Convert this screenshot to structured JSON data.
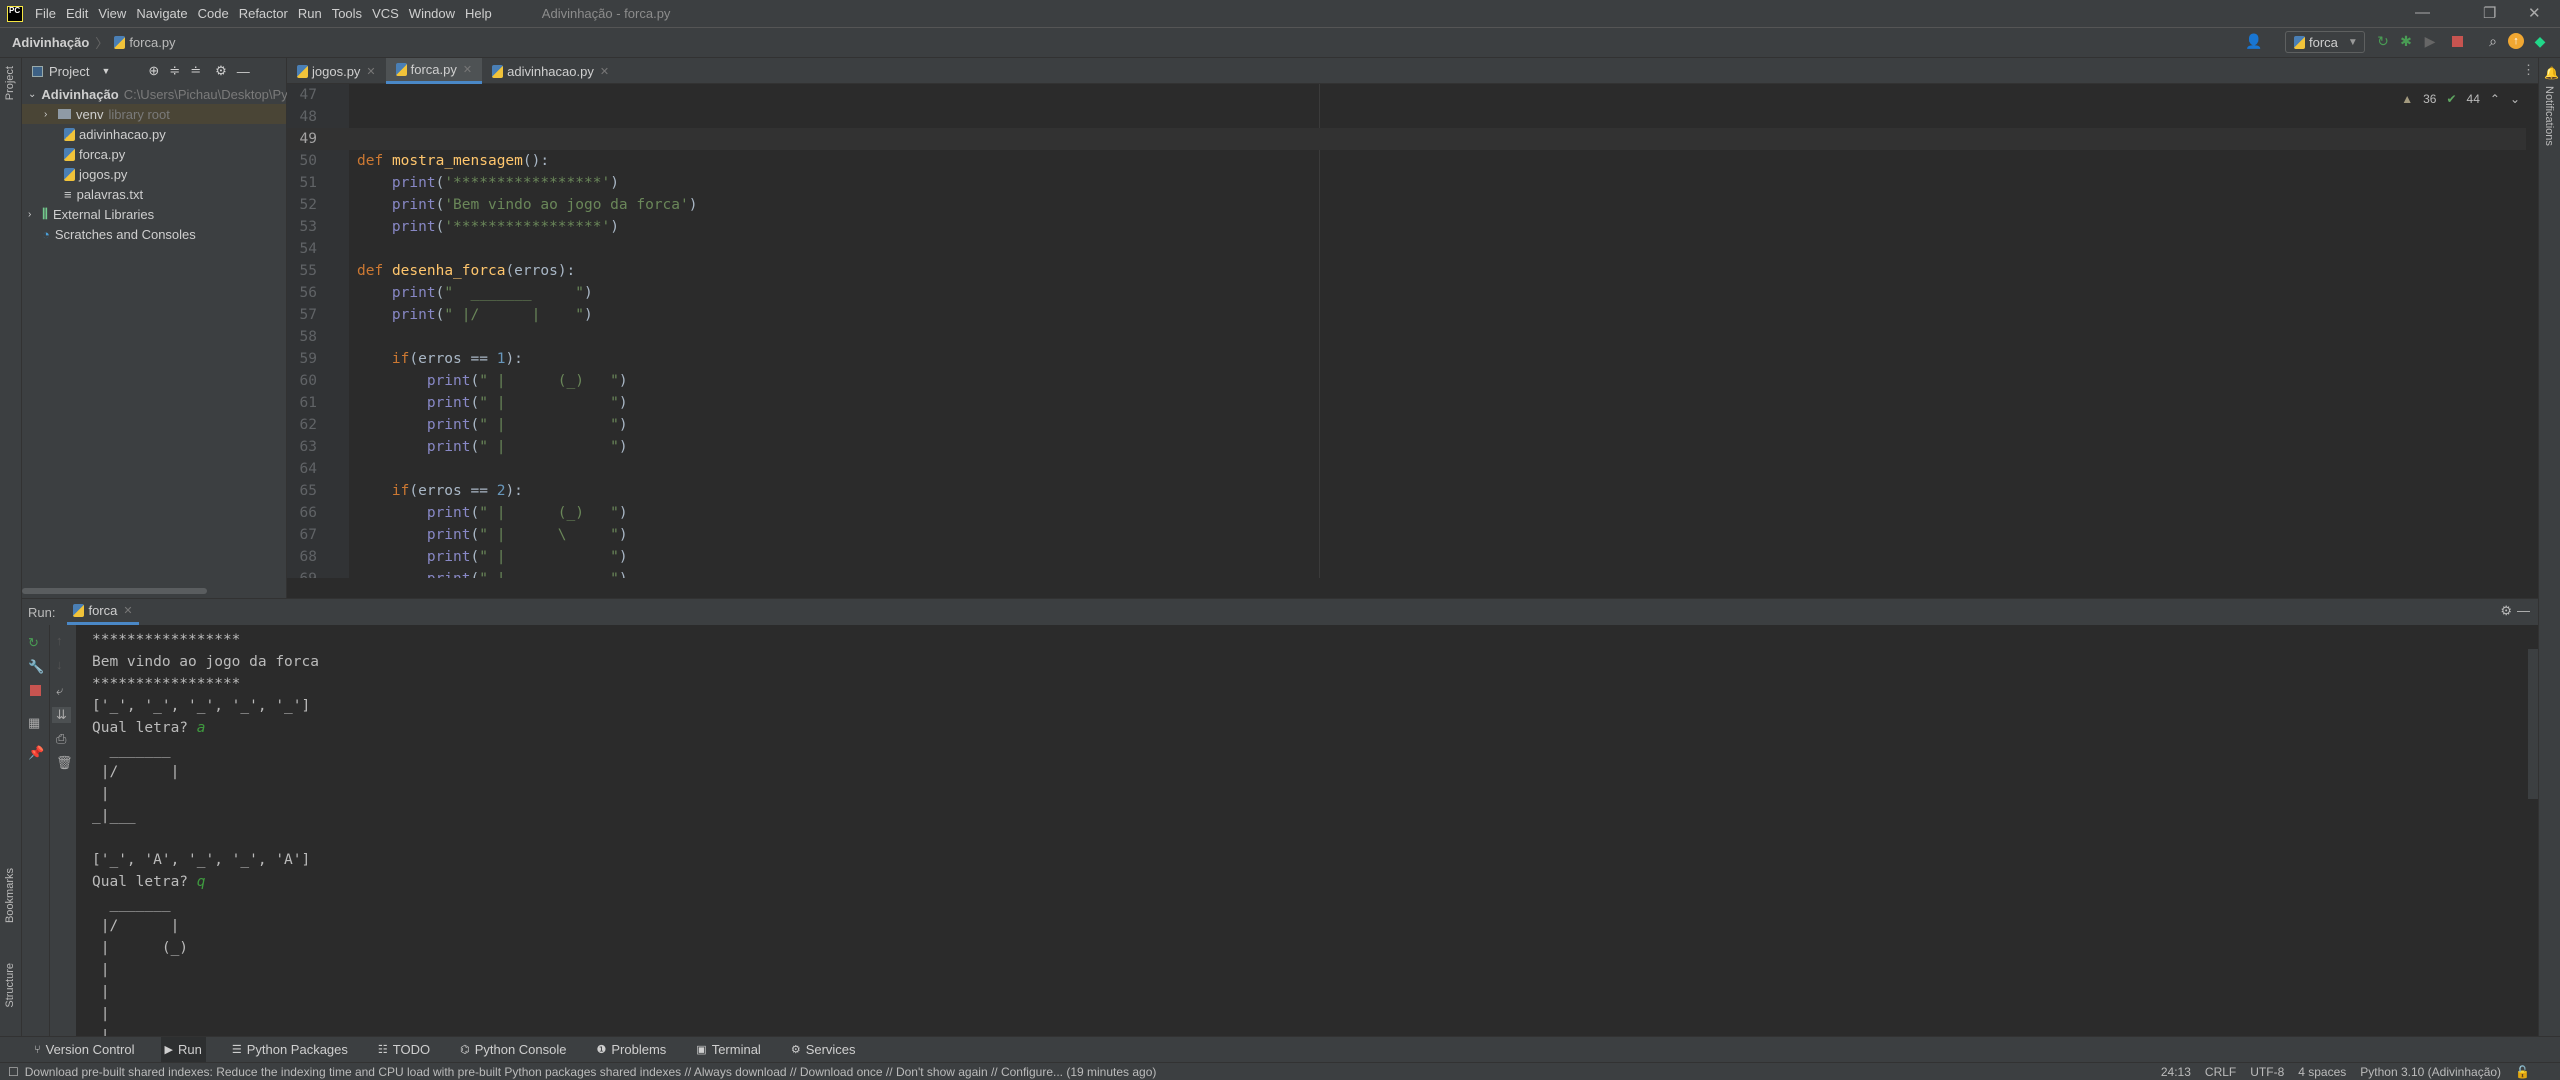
{
  "titlebar": {
    "menu": [
      "File",
      "Edit",
      "View",
      "Navigate",
      "Code",
      "Refactor",
      "Run",
      "Tools",
      "VCS",
      "Window",
      "Help"
    ],
    "title": "Adivinhação - forca.py",
    "logo": "PC"
  },
  "breadcrumb": {
    "project": "Adivinhação",
    "file": "forca.py"
  },
  "toolbar": {
    "run_config": "forca",
    "icons": [
      "user-icon",
      "rerun-icon",
      "debug-icon",
      "coverage-icon",
      "stop-icon",
      "search-icon",
      "update-icon",
      "toolbox-icon"
    ],
    "stop_color": "#c75450"
  },
  "left_stripe": {
    "project": "Project",
    "bookmarks": "Bookmarks",
    "structure": "Structure"
  },
  "right_stripe": {
    "notifications": "Notifications"
  },
  "project_panel": {
    "title": "Project",
    "root": {
      "name": "Adivinhação",
      "path": "C:\\Users\\Pichau\\Desktop\\Py"
    },
    "venv": {
      "name": "venv",
      "note": "library root"
    },
    "files": [
      "adivinhacao.py",
      "forca.py",
      "jogos.py",
      "palavras.txt"
    ],
    "external": "External Libraries",
    "scratches": "Scratches and Consoles"
  },
  "editor": {
    "tabs": [
      {
        "label": "jogos.py",
        "active": false
      },
      {
        "label": "forca.py",
        "active": true
      },
      {
        "label": "adivinhacao.py",
        "active": false
      }
    ],
    "warnings": "36",
    "weak_warnings": "44",
    "current_line": 49,
    "lines": [
      {
        "n": "47",
        "t": ""
      },
      {
        "n": "48",
        "t": ""
      },
      {
        "n": "49",
        "t": ""
      },
      {
        "n": "50",
        "t": "def mostra_mensagem():"
      },
      {
        "n": "51",
        "t": "    print('*****************')"
      },
      {
        "n": "52",
        "t": "    print('Bem vindo ao jogo da forca')"
      },
      {
        "n": "53",
        "t": "    print('*****************')"
      },
      {
        "n": "54",
        "t": ""
      },
      {
        "n": "55",
        "t": "def desenha_forca(erros):"
      },
      {
        "n": "56",
        "t": "    print(\"  _______     \")"
      },
      {
        "n": "57",
        "t": "    print(\" |/      |    \")"
      },
      {
        "n": "58",
        "t": ""
      },
      {
        "n": "59",
        "t": "    if(erros == 1):"
      },
      {
        "n": "60",
        "t": "        print(\" |      (_)   \")"
      },
      {
        "n": "61",
        "t": "        print(\" |            \")"
      },
      {
        "n": "62",
        "t": "        print(\" |            \")"
      },
      {
        "n": "63",
        "t": "        print(\" |            \")"
      },
      {
        "n": "64",
        "t": ""
      },
      {
        "n": "65",
        "t": "    if(erros == 2):"
      },
      {
        "n": "66",
        "t": "        print(\" |      (_)   \")"
      },
      {
        "n": "67",
        "t": "        print(\" |      \\     \")"
      },
      {
        "n": "68",
        "t": "        print(\" |            \")"
      },
      {
        "n": "69",
        "t": "        print(\" |            \")"
      }
    ]
  },
  "run_panel": {
    "label": "Run:",
    "tab": "forca",
    "output": [
      {
        "t": "*****************"
      },
      {
        "t": "Bem vindo ao jogo da forca"
      },
      {
        "t": "*****************"
      },
      {
        "t": "['_', '_', '_', '_', '_']"
      },
      {
        "t": "Qual letra? ",
        "input": "a"
      },
      {
        "t": "  _______"
      },
      {
        "t": " |/      |"
      },
      {
        "t": " |"
      },
      {
        "t": "_|___"
      },
      {
        "t": ""
      },
      {
        "t": "['_', 'A', '_', '_', 'A']"
      },
      {
        "t": "Qual letra? ",
        "input": "q"
      },
      {
        "t": "  _______"
      },
      {
        "t": " |/      |"
      },
      {
        "t": " |      (_)"
      },
      {
        "t": " |"
      },
      {
        "t": " |"
      },
      {
        "t": " |"
      },
      {
        "t": " |"
      }
    ]
  },
  "bottom_tools": [
    "Version Control",
    "Run",
    "Python Packages",
    "TODO",
    "Python Console",
    "Problems",
    "Terminal",
    "Services"
  ],
  "status": {
    "message": "Download pre-built shared indexes: Reduce the indexing time and CPU load with pre-built Python packages shared indexes // Always download // Download once // Don't show again // Configure... (19 minutes ago)",
    "position": "24:13",
    "line_sep": "CRLF",
    "encoding": "UTF-8",
    "indent": "4 spaces",
    "interpreter": "Python 3.10 (Adivinhação)"
  }
}
